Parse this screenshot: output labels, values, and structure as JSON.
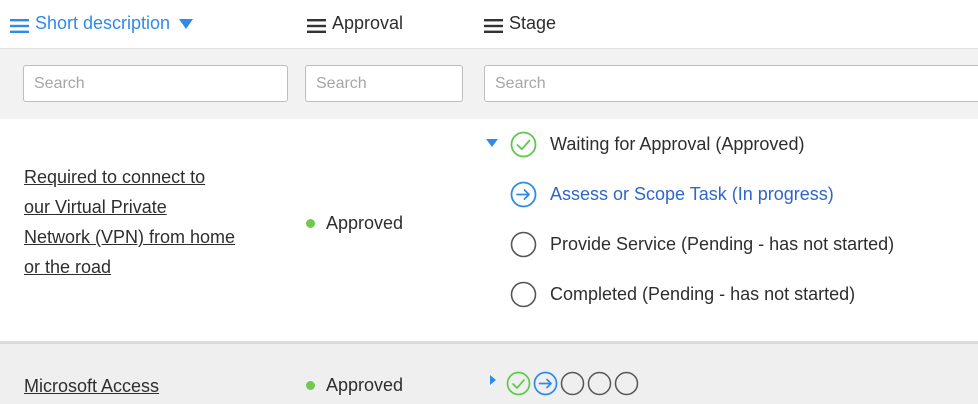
{
  "columns": [
    {
      "label": "Short description",
      "sorted": true
    },
    {
      "label": "Approval",
      "sorted": false
    },
    {
      "label": "Stage",
      "sorted": false
    }
  ],
  "search": {
    "desc_placeholder": "Search",
    "approval_placeholder": "Search",
    "stage_placeholder": "Search"
  },
  "rows": [
    {
      "description_lines": [
        "Required to connect to",
        "our Virtual Private",
        "Network (VPN) from home",
        "or the road"
      ],
      "approval": "Approved",
      "expanded": true,
      "stages": [
        {
          "label": "Waiting for Approval (Approved)",
          "status": "complete"
        },
        {
          "label": "Assess or Scope Task (In progress)",
          "status": "in-progress"
        },
        {
          "label": "Provide Service (Pending - has not started)",
          "status": "pending"
        },
        {
          "label": "Completed (Pending - has not started)",
          "status": "pending"
        }
      ]
    },
    {
      "description_lines": [
        "Microsoft Access"
      ],
      "approval": "Approved",
      "expanded": false,
      "stage_icons": [
        "complete",
        "in-progress",
        "pending",
        "pending",
        "pending"
      ]
    }
  ],
  "colors": {
    "link_blue": "#2f8ae8",
    "approved_green": "#71c94e",
    "complete_green": "#5cc94a",
    "pending_gray": "#555555"
  }
}
